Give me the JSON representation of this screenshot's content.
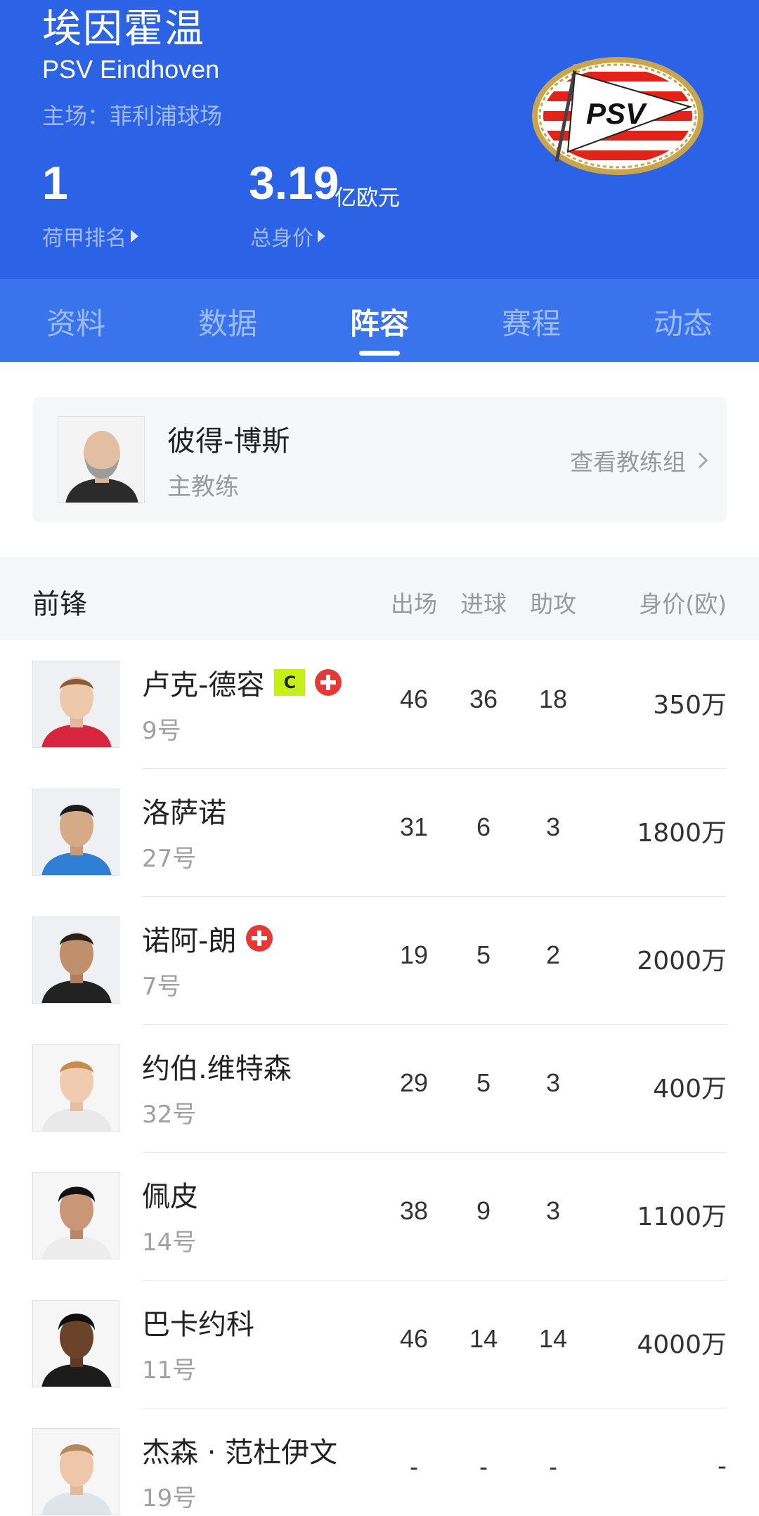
{
  "team": {
    "name_cn": "埃因霍温",
    "name_en": "PSV Eindhoven",
    "venue": "主场：菲利浦球场",
    "rank_value": "1",
    "rank_label": "荷甲排名",
    "value_amount": "3.19",
    "value_unit": "亿欧元",
    "value_label": "总身价",
    "logo_text": "PSV"
  },
  "tabs": [
    {
      "label": "资料"
    },
    {
      "label": "数据"
    },
    {
      "label": "阵容",
      "active": true
    },
    {
      "label": "赛程"
    },
    {
      "label": "动态"
    }
  ],
  "coach": {
    "name": "彼得-博斯",
    "role": "主教练",
    "link": "查看教练组"
  },
  "section": {
    "title": "前锋",
    "columns": [
      "出场",
      "进球",
      "助攻",
      "身价(欧)"
    ]
  },
  "players": [
    {
      "name": "卢克-德容",
      "number": "9号",
      "apps": "46",
      "goals": "36",
      "assists": "18",
      "value": "350万",
      "captain_badge": "C",
      "injury_badge": true
    },
    {
      "name": "洛萨诺",
      "number": "27号",
      "apps": "31",
      "goals": "6",
      "assists": "3",
      "value": "1800万"
    },
    {
      "name": "诺阿-朗",
      "number": "7号",
      "apps": "19",
      "goals": "5",
      "assists": "2",
      "value": "2000万",
      "injury_badge": true
    },
    {
      "name": "约伯.维特森",
      "number": "32号",
      "apps": "29",
      "goals": "5",
      "assists": "3",
      "value": "400万"
    },
    {
      "name": "佩皮",
      "number": "14号",
      "apps": "38",
      "goals": "9",
      "assists": "3",
      "value": "1100万"
    },
    {
      "name": "巴卡约科",
      "number": "11号",
      "apps": "46",
      "goals": "14",
      "assists": "14",
      "value": "4000万"
    },
    {
      "name": " 杰森 · 范杜伊文",
      "number": "19号",
      "apps": "-",
      "goals": "-",
      "assists": "-",
      "value": "-"
    }
  ],
  "colors": {
    "header_bg": "#2c62e6",
    "tabs_bg": "#3a74ec",
    "captain_badge": "#c6ef17",
    "injury_badge": "#e53935",
    "psv_red": "#e2231a",
    "psv_gold": "#c9a64b"
  }
}
